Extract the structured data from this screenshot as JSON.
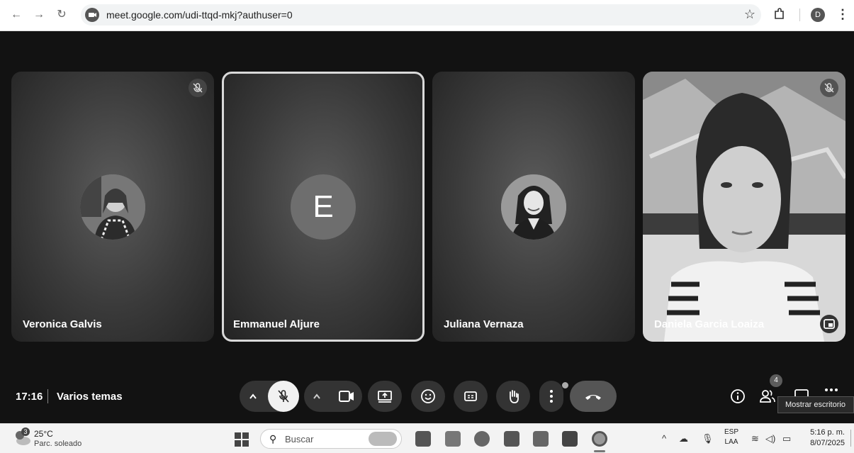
{
  "browser": {
    "url": "meet.google.com/udi-ttqd-mkj?authuser=0",
    "profile_initial": "D"
  },
  "participants": [
    {
      "name": "Veronica Galvis",
      "muted": true,
      "avatar": "photo"
    },
    {
      "name": "Emmanuel Aljure",
      "muted": false,
      "avatar": "letter",
      "initial": "E",
      "speaking": true
    },
    {
      "name": "Juliana Vernaza",
      "muted": false,
      "avatar": "photo"
    },
    {
      "name": "Daniela Garcia Loaiza",
      "muted": true,
      "avatar": "video"
    }
  ],
  "meeting": {
    "time": "17:16",
    "title": "Varios temas",
    "participant_count": "4"
  },
  "tooltip": "Mostrar escritorio",
  "taskbar": {
    "weather_temp": "25°C",
    "weather_desc": "Parc. soleado",
    "weather_badge": "3",
    "search_placeholder": "Buscar",
    "lang_1": "ESP",
    "lang_2": "LAA",
    "clock_time": "5:16 p. m.",
    "clock_date": "8/07/2025"
  },
  "colors": {
    "meet_bg": "#121212",
    "tile_bg": "#3a3a3a",
    "control_bg": "#333333",
    "taskbar_bg": "#f3f3f3"
  }
}
